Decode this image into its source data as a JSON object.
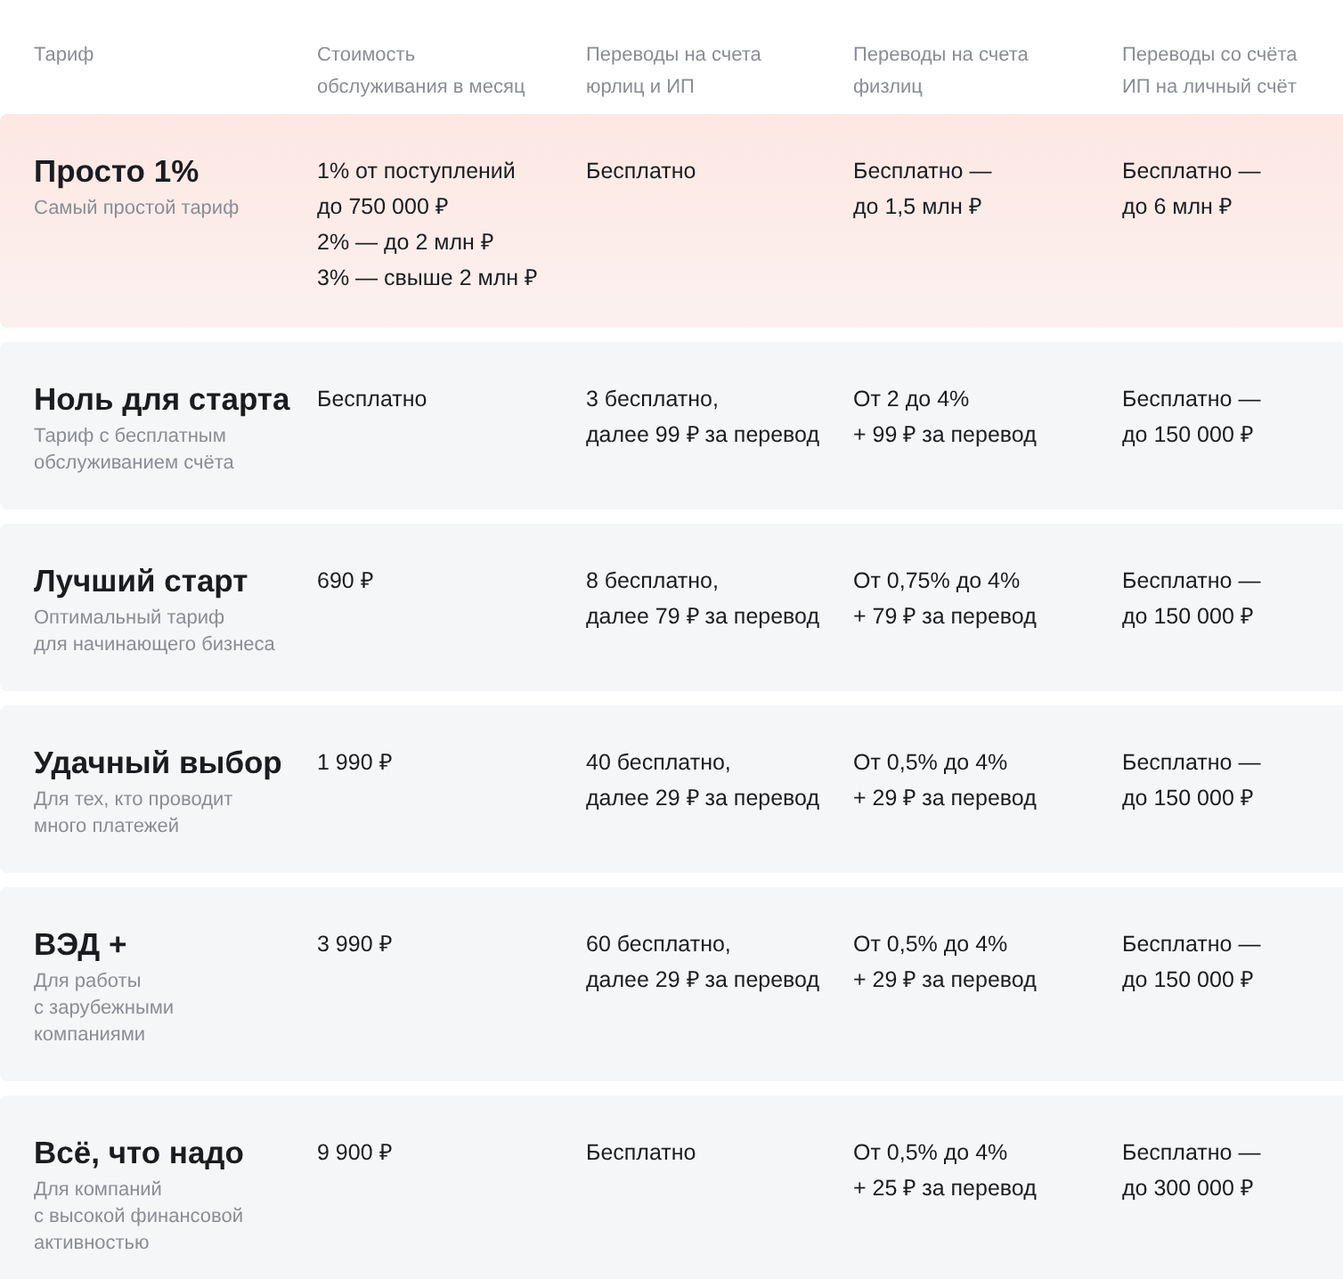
{
  "columns": [
    "Тариф",
    "Стоимость обслуживания в месяц",
    "Переводы на счета юрлиц и ИП",
    "Переводы на счета физлиц",
    "Переводы со счёта ИП на личный счёт"
  ],
  "tariffs": [
    {
      "name": "Просто 1%",
      "description": [
        "Самый простой тариф"
      ],
      "highlighted": true,
      "cells": [
        [
          "1% от поступлений",
          "до 750 000 ₽",
          "2% — до 2 млн ₽",
          "3% — свыше 2 млн ₽"
        ],
        [
          "Бесплатно"
        ],
        [
          "Бесплатно —",
          "до 1,5 млн ₽"
        ],
        [
          "Бесплатно —",
          "до 6 млн ₽"
        ]
      ]
    },
    {
      "name": "Ноль для старта",
      "description": [
        "Тариф с бесплатным",
        "обслуживанием счёта"
      ],
      "highlighted": false,
      "cells": [
        [
          "Бесплатно"
        ],
        [
          "3 бесплатно,",
          "далее 99 ₽ за перевод"
        ],
        [
          "От 2 до 4%",
          "+ 99 ₽ за перевод"
        ],
        [
          "Бесплатно —",
          "до 150 000 ₽"
        ]
      ]
    },
    {
      "name": "Лучший старт",
      "description": [
        "Оптимальный тариф",
        "для начинающего бизнеса"
      ],
      "highlighted": false,
      "cells": [
        [
          "690 ₽"
        ],
        [
          "8 бесплатно,",
          "далее 79 ₽ за перевод"
        ],
        [
          "От 0,75% до 4%",
          "+ 79 ₽ за перевод"
        ],
        [
          "Бесплатно —",
          "до 150 000 ₽"
        ]
      ]
    },
    {
      "name": "Удачный выбор",
      "description": [
        "Для тех, кто проводит",
        "много платежей"
      ],
      "highlighted": false,
      "cells": [
        [
          "1 990 ₽"
        ],
        [
          "40 бесплатно,",
          "далее 29 ₽ за перевод"
        ],
        [
          "От 0,5% до 4%",
          "+ 29 ₽ за перевод"
        ],
        [
          "Бесплатно —",
          "до 150 000 ₽"
        ]
      ]
    },
    {
      "name": "ВЭД +",
      "description": [
        "Для работы",
        "с зарубежными",
        "компаниями"
      ],
      "highlighted": false,
      "cells": [
        [
          "3 990 ₽"
        ],
        [
          "60 бесплатно,",
          "далее 29 ₽ за перевод"
        ],
        [
          "От 0,5% до 4%",
          "+ 29 ₽ за перевод"
        ],
        [
          "Бесплатно —",
          "до 150 000 ₽"
        ]
      ]
    },
    {
      "name": "Всё, что надо",
      "description": [
        "Для компаний",
        "с высокой финансовой",
        "активностью"
      ],
      "highlighted": false,
      "cells": [
        [
          "9 900 ₽"
        ],
        [
          "Бесплатно"
        ],
        [
          "От 0,5% до 4%",
          "+ 25 ₽ за перевод"
        ],
        [
          "Бесплатно —",
          "до 300 000 ₽"
        ]
      ]
    }
  ]
}
